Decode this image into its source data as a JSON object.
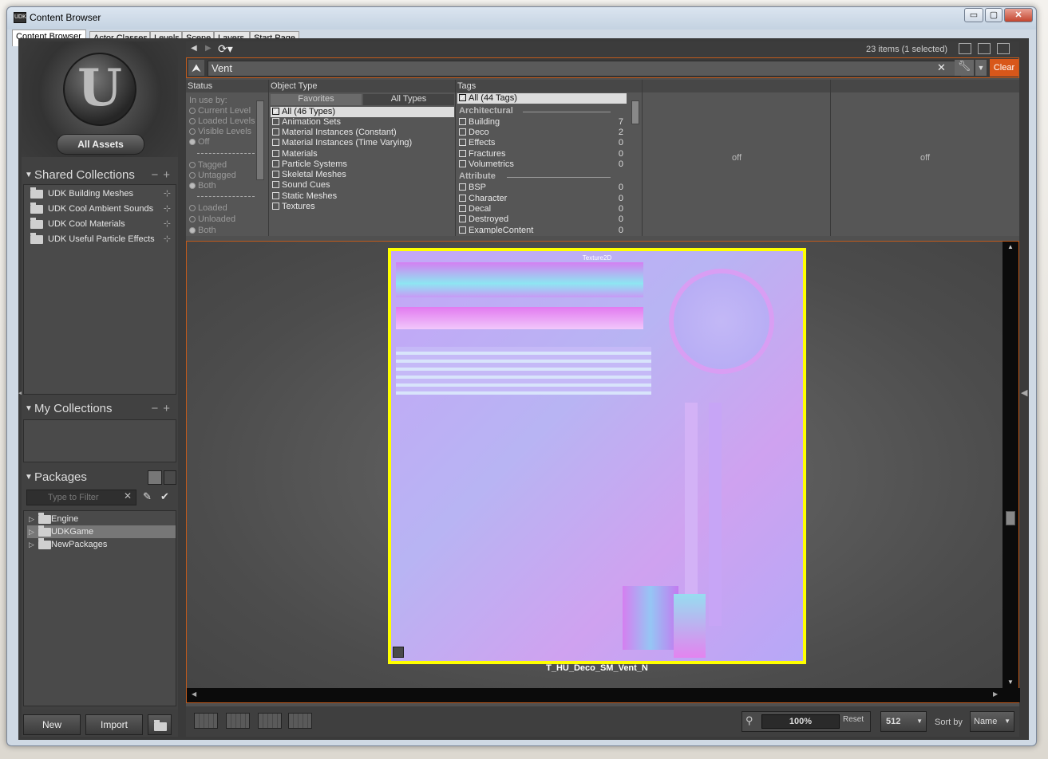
{
  "window": {
    "title": "Content Browser",
    "icon_label": "UDK",
    "minimize": "▭",
    "maximize": "▢",
    "close": "✕"
  },
  "tabs": [
    "Content Browser",
    "Actor Classes",
    "Levels",
    "Scene",
    "Layers",
    "Start Page"
  ],
  "left": {
    "all_assets": "All Assets",
    "logo_letter": "U",
    "shared_collections": {
      "title": "Shared Collections",
      "controls": "−+",
      "items": [
        "UDK Building Meshes",
        "UDK Cool Ambient Sounds",
        "UDK Cool Materials",
        "UDK Useful Particle Effects"
      ]
    },
    "my_collections": {
      "title": "My Collections",
      "controls": "−+"
    },
    "packages": {
      "title": "Packages",
      "filter_placeholder": "Type to Filter",
      "items": [
        "Engine",
        "UDKGame",
        "NewPackages"
      ],
      "selected_index": 1
    },
    "new_button": "New",
    "import_button": "Import"
  },
  "toolbar": {
    "back": "◀",
    "forward": "▶",
    "refresh": "⟳▾",
    "status": "23 items (1 selected)"
  },
  "search": {
    "value": "Vent",
    "clear_x": "✕",
    "clear_button": "Clear",
    "collapse_icon": "⮝"
  },
  "filters": {
    "status": {
      "header": "Status",
      "in_use_by": "In use by:",
      "in_use_options": [
        "Current Level",
        "Loaded Levels",
        "Visible Levels",
        "Off"
      ],
      "tagged_options": [
        "Tagged",
        "Untagged",
        "Both"
      ],
      "loaded_options": [
        "Loaded",
        "Unloaded",
        "Both"
      ]
    },
    "object_type": {
      "header": "Object Type",
      "subtabs": [
        "Favorites",
        "All Types"
      ],
      "items": [
        "All (46 Types)",
        "Animation Sets",
        "Material Instances (Constant)",
        "Material Instances (Time Varying)",
        "Materials",
        "Particle Systems",
        "Skeletal Meshes",
        "Sound Cues",
        "Static Meshes",
        "Textures"
      ]
    },
    "tags": {
      "header": "Tags",
      "all": "All (44 Tags)",
      "groups": [
        {
          "name": "Architectural",
          "items": [
            [
              "Building",
              "7"
            ],
            [
              "Deco",
              "2"
            ],
            [
              "Effects",
              "0"
            ],
            [
              "Fractures",
              "0"
            ],
            [
              "Volumetrics",
              "0"
            ]
          ]
        },
        {
          "name": "Attribute",
          "items": [
            [
              "BSP",
              "0"
            ],
            [
              "Character",
              "0"
            ],
            [
              "Decal",
              "0"
            ],
            [
              "Destroyed",
              "0"
            ],
            [
              "ExampleContent",
              "0"
            ]
          ]
        }
      ]
    },
    "col4": "off",
    "col5": "off"
  },
  "asset": {
    "type_label": "Texture2D",
    "name": "T_HU_Deco_SM_Vent_N"
  },
  "bottom": {
    "zoom": "100%",
    "reset": "Reset",
    "size": "512",
    "sort_label": "Sort by",
    "sort_value": "Name"
  },
  "colors": {
    "accent_orange": "#c05a1c",
    "selection_yellow": "#ffff00",
    "clear_button": "#d8571a"
  }
}
